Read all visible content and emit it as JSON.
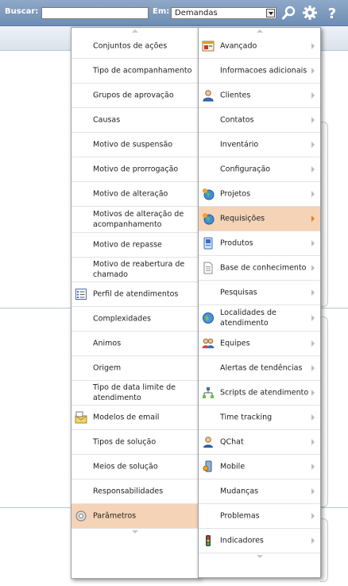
{
  "topbar": {
    "search_label": "Buscar:",
    "search_value": "",
    "in_label": "Em:",
    "in_value": "Demandas",
    "icons": [
      "search-icon",
      "gear-icon",
      "help-icon"
    ]
  },
  "left_menu": {
    "items": [
      {
        "label": "Conjuntos de ações"
      },
      {
        "label": "Tipo de acompanhamento"
      },
      {
        "label": "Grupos de aprovação"
      },
      {
        "label": "Causas"
      },
      {
        "label": "Motivo de suspensão"
      },
      {
        "label": "Motivo de prorrogação"
      },
      {
        "label": "Motivo de alteração"
      },
      {
        "label": "Motivos de alteração de acompanhamento"
      },
      {
        "label": "Motivo de repasse"
      },
      {
        "label": "Motivo de reabertura de chamado"
      },
      {
        "label": "Perfil de atendimentos",
        "icon": "list-icon"
      },
      {
        "label": "Complexidades"
      },
      {
        "label": "Animos"
      },
      {
        "label": "Origem"
      },
      {
        "label": "Tipo de data limite de atendimento"
      },
      {
        "label": "Modelos de email",
        "icon": "email-template-icon"
      },
      {
        "label": "Tipos de solução"
      },
      {
        "label": "Meios de solução"
      },
      {
        "label": "Responsabilidades"
      },
      {
        "label": "Parâmetros",
        "icon": "parameters-icon",
        "selected": true
      }
    ]
  },
  "right_menu": {
    "items": [
      {
        "label": "Avançado",
        "icon": "advanced-icon"
      },
      {
        "label": "Informacoes adicionais"
      },
      {
        "label": "Clientes",
        "icon": "user-icon"
      },
      {
        "label": "Contatos"
      },
      {
        "label": "Inventário"
      },
      {
        "label": "Configuração"
      },
      {
        "label": "Projetos",
        "icon": "projects-icon"
      },
      {
        "label": "Requisições",
        "icon": "requests-icon",
        "selected": true
      },
      {
        "label": "Produtos",
        "icon": "products-icon"
      },
      {
        "label": "Base de conhecimento",
        "icon": "document-icon"
      },
      {
        "label": "Pesquisas"
      },
      {
        "label": "Localidades de atendimento",
        "icon": "globe-icon"
      },
      {
        "label": "Equipes",
        "icon": "team-icon"
      },
      {
        "label": "Alertas de tendências"
      },
      {
        "label": "Scripts de atendimento",
        "icon": "scripts-icon"
      },
      {
        "label": "Time tracking"
      },
      {
        "label": "QChat",
        "icon": "chat-icon"
      },
      {
        "label": "Mobile",
        "icon": "mobile-icon"
      },
      {
        "label": "Mudanças"
      },
      {
        "label": "Problemas"
      },
      {
        "label": "Indicadores",
        "icon": "traffic-light-icon"
      }
    ]
  }
}
